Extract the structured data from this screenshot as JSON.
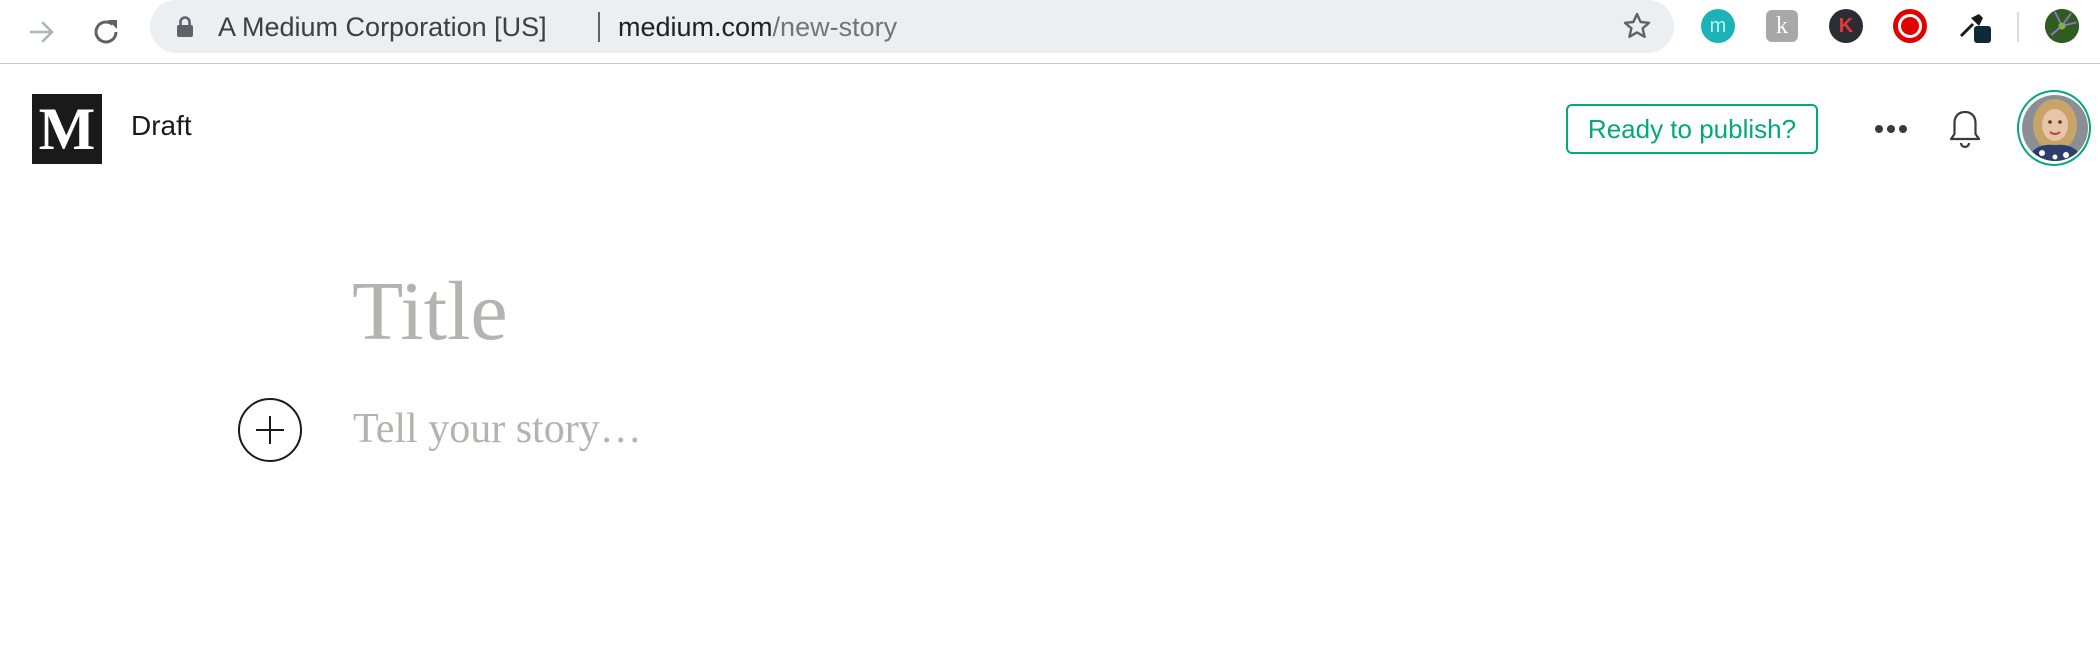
{
  "browser": {
    "site_identity": "A Medium Corporation [US]",
    "url_host": "medium.com",
    "url_path": "/new-story",
    "icons": {
      "forward": "forward-arrow-icon",
      "reload": "reload-icon",
      "lock": "lock-icon",
      "bookmark": "star-icon"
    },
    "extensions": [
      {
        "name": "m-extension-icon",
        "letter": "m",
        "color": "#1bb3b8"
      },
      {
        "name": "k-extension-icon",
        "letter": "k",
        "color": "#a8a8a8"
      },
      {
        "name": "k-red-extension-icon",
        "letter": "K",
        "color": "#c62828"
      },
      {
        "name": "record-extension-icon",
        "color": "#e00000"
      },
      {
        "name": "eyedropper-extension-icon"
      },
      {
        "name": "profile-extension-icon",
        "color": "#2e7d32"
      }
    ]
  },
  "header": {
    "logo_letter": "M",
    "status": "Draft",
    "publish_label": "Ready to publish?",
    "accent_color": "#03a87c"
  },
  "editor": {
    "title_placeholder": "Title",
    "body_placeholder": "Tell your story…"
  }
}
